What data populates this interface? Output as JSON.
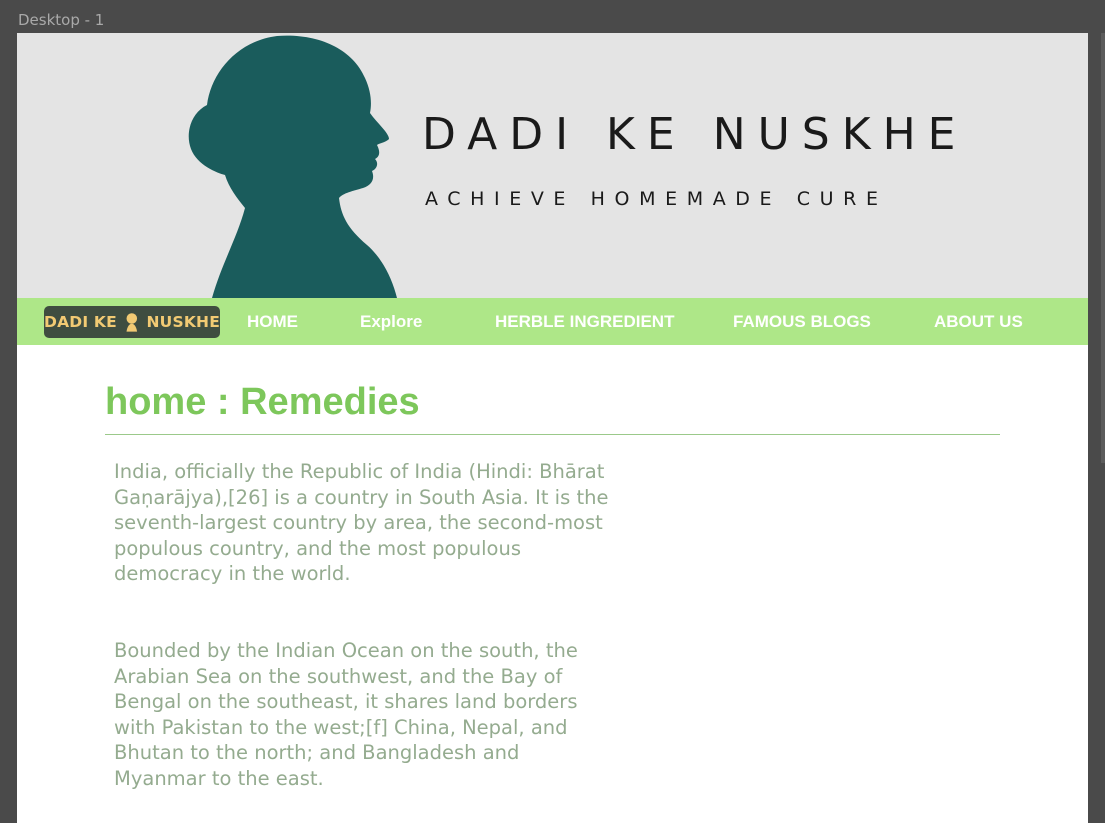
{
  "window": {
    "frame_label": "Desktop - 1"
  },
  "banner": {
    "title": "DADI KE NUSKHE",
    "tagline": "ACHIEVE HOMEMADE CURE",
    "silhouette_color": "#1a5c5c"
  },
  "navbar": {
    "background": "#aee788",
    "logo": {
      "left_word": "DADI KE",
      "right_word": "NUSKHE",
      "icon": "woman-head-icon"
    },
    "links": [
      {
        "label": "HOME"
      },
      {
        "label": "Explore"
      },
      {
        "label": "HERBLE INGREDIENT"
      },
      {
        "label": "FAMOUS BLOGS"
      },
      {
        "label": "ABOUT US"
      }
    ]
  },
  "main": {
    "heading": "home : Remedies",
    "accent_color": "#7dc75b",
    "paragraphs": [
      "India, officially the Republic of India (Hindi: Bhārat Gaṇarājya),[26] is a country in South Asia. It is the seventh-largest country by area, the second-most populous country, and the most populous democracy in the world.",
      "Bounded by the Indian Ocean on the south, the Arabian Sea on the southwest, and the Bay of Bengal on the southeast, it shares land borders with Pakistan to the west;[f] China, Nepal, and Bhutan to the north; and Bangladesh and Myanmar to the east."
    ]
  }
}
